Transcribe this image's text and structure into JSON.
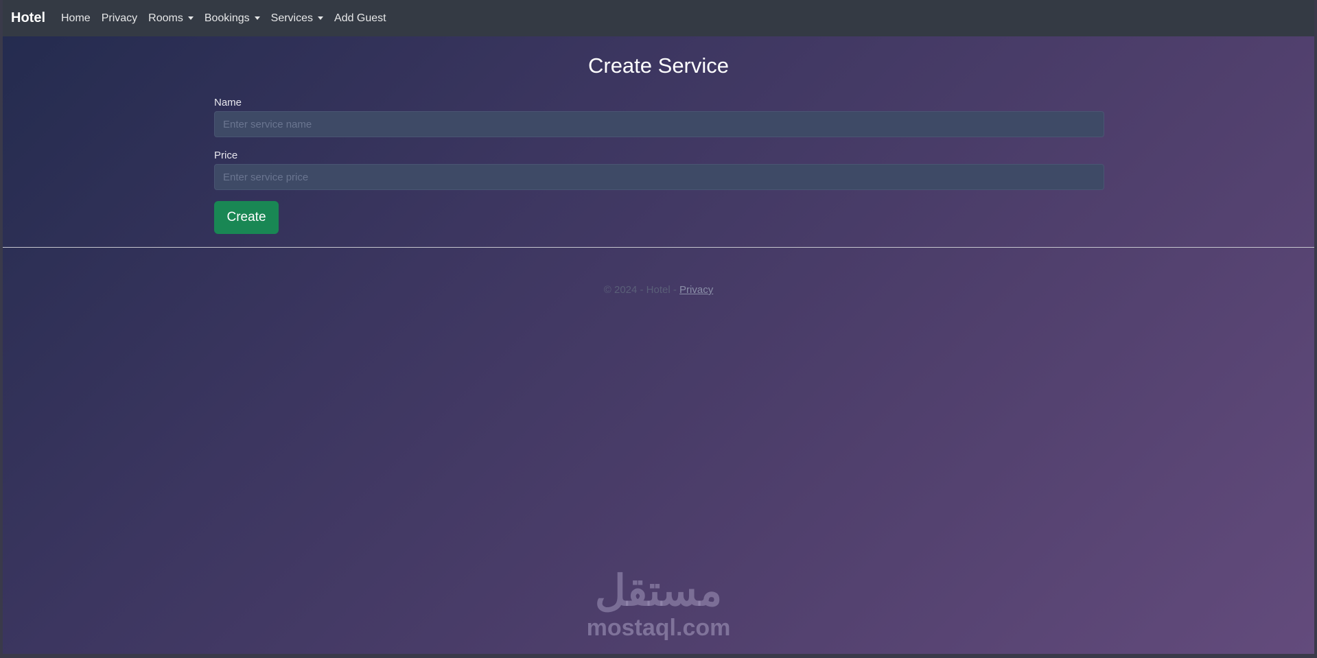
{
  "navbar": {
    "brand": "Hotel",
    "items": [
      {
        "label": "Home",
        "dropdown": false
      },
      {
        "label": "Privacy",
        "dropdown": false
      },
      {
        "label": "Rooms",
        "dropdown": true
      },
      {
        "label": "Bookings",
        "dropdown": true
      },
      {
        "label": "Services",
        "dropdown": true
      },
      {
        "label": "Add Guest",
        "dropdown": false
      }
    ]
  },
  "page": {
    "title": "Create Service"
  },
  "form": {
    "name_label": "Name",
    "name_placeholder": "Enter service name",
    "name_value": "",
    "price_label": "Price",
    "price_placeholder": "Enter service price",
    "price_value": "",
    "submit_label": "Create"
  },
  "footer": {
    "text": "© 2024 - Hotel - ",
    "privacy_link": "Privacy"
  },
  "watermark": {
    "logo": "مستقل",
    "text": "mostaql.com"
  },
  "colors": {
    "navbar_bg": "#343a44",
    "button_green": "#198754",
    "input_bg": "#3e4a66",
    "gradient_start": "#232b4e",
    "gradient_end": "#634b7c"
  }
}
